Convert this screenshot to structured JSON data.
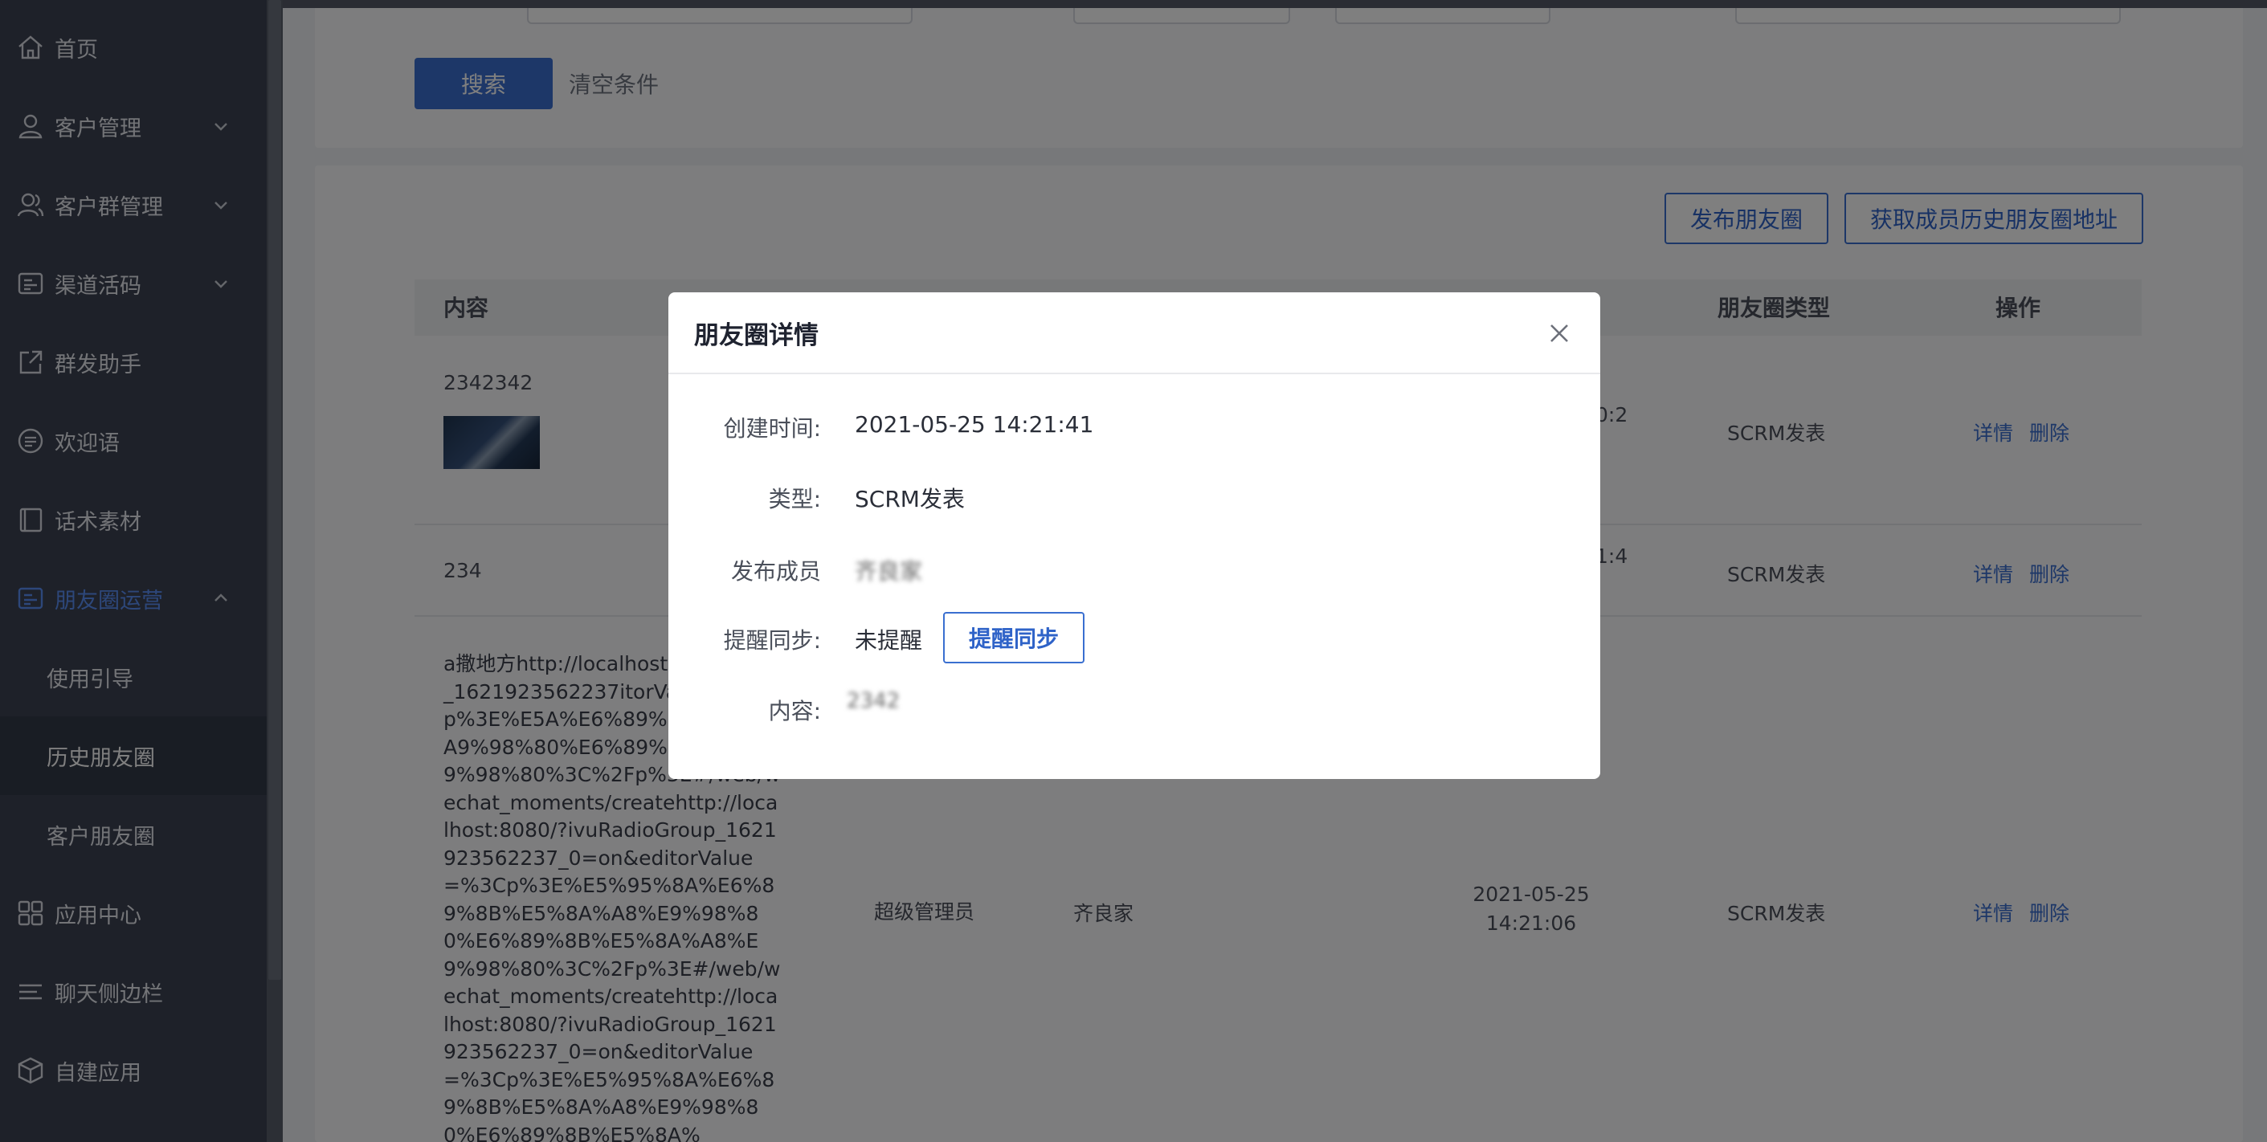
{
  "sidebar": {
    "items": [
      {
        "label": "首页",
        "icon": "home-icon"
      },
      {
        "label": "客户管理",
        "icon": "user-icon"
      },
      {
        "label": "客户群管理",
        "icon": "users-icon"
      },
      {
        "label": "渠道活码",
        "icon": "qrcode-icon"
      },
      {
        "label": "群发助手",
        "icon": "share-icon"
      },
      {
        "label": "欢迎语",
        "icon": "chat-icon"
      },
      {
        "label": "话术素材",
        "icon": "book-icon"
      },
      {
        "label": "朋友圈运营",
        "icon": "moments-icon"
      },
      {
        "label": "使用引导"
      },
      {
        "label": "历史朋友圈"
      },
      {
        "label": "客户朋友圈"
      },
      {
        "label": "应用中心",
        "icon": "apps-icon"
      },
      {
        "label": "聊天侧边栏",
        "icon": "list-icon"
      },
      {
        "label": "自建应用",
        "icon": "cube-icon"
      }
    ]
  },
  "filter": {
    "search_label": "搜索",
    "clear_label": "清空条件"
  },
  "toolbar": {
    "publish_label": "发布朋友圈",
    "fetch_history_label": "获取成员历史朋友圈地址"
  },
  "table": {
    "headers": {
      "content": "内容",
      "type": "朋友圈类型",
      "action": "操作"
    },
    "rows": [
      {
        "content": "2342342",
        "time_fragment": "0:2",
        "type": "SCRM发表",
        "detail": "详情",
        "delete": "删除"
      },
      {
        "content": "234",
        "time_fragment": "1:4",
        "type": "SCRM发表",
        "detail": "详情",
        "delete": "删除"
      },
      {
        "content": "a撒地方http://localhost:8dioGroup_1621923562237itorValue=%3Cp%3E%E5A%E6%89%8B%E5%8A9%98%80%E6%89%8BA8%E9%98%80%3C%2Fp%3E#/web/wechat_moments/createhttp://localhost:8080/?ivuRadioGroup_1621923562237_0=on&editorValue=%3Cp%3E%E5%95%8A%E6%89%8B%E5%8A%A8%E9%98%80%E6%89%8B%E5%8A%A8%E9%98%80%3C%2Fp%3E#/web/wechat_moments/createhttp://localhost:8080/?ivuRadioGroup_1621923562237_0=on&editorValue=%3Cp%3E%E5%95%8A%E6%89%8B%E5%8A%A8%E9%98%80%E6%89%8B%E5%8A%",
        "creator": "超级管理员",
        "member": "齐良家",
        "time": "2021-05-25 14:21:06",
        "type": "SCRM发表",
        "detail": "详情",
        "delete": "删除"
      }
    ]
  },
  "modal": {
    "title": "朋友圈详情",
    "fields": {
      "created_label": "创建时间:",
      "created_value": "2021-05-25 14:21:41",
      "type_label": "类型:",
      "type_value": "SCRM发表",
      "member_label": "发布成员",
      "member_value": "齐良家",
      "remind_label": "提醒同步:",
      "remind_value": "未提醒",
      "remind_button": "提醒同步",
      "content_label": "内容:",
      "content_value": "2342"
    }
  },
  "colors": {
    "sidebar_bg": "#3c4353",
    "primary": "#3a6fd0",
    "active_menu": "#5b8ff5"
  }
}
